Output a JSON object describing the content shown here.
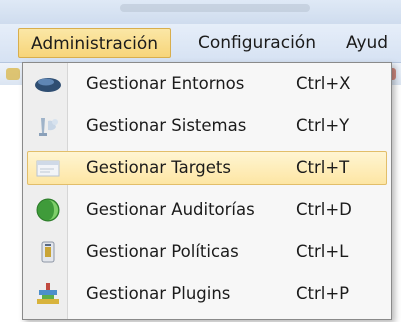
{
  "menubar": {
    "items": [
      {
        "label": "Administración",
        "active": true
      },
      {
        "label": "Configuración",
        "active": false
      },
      {
        "label": "Ayud",
        "active": false
      }
    ]
  },
  "dropdown": {
    "items": [
      {
        "label": "Gestionar Entornos",
        "shortcut": "Ctrl+X",
        "icon": "environment-icon",
        "highlighted": false
      },
      {
        "label": "Gestionar Sistemas",
        "shortcut": "Ctrl+Y",
        "icon": "systems-icon",
        "highlighted": false
      },
      {
        "label": "Gestionar Targets",
        "shortcut": "Ctrl+T",
        "icon": "targets-icon",
        "highlighted": true
      },
      {
        "label": "Gestionar Auditorías",
        "shortcut": "Ctrl+D",
        "icon": "audits-icon",
        "highlighted": false
      },
      {
        "label": "Gestionar Políticas",
        "shortcut": "Ctrl+L",
        "icon": "policies-icon",
        "highlighted": false
      },
      {
        "label": "Gestionar Plugins",
        "shortcut": "Ctrl+P",
        "icon": "plugins-icon",
        "highlighted": false
      }
    ]
  },
  "colors": {
    "highlight": "#fde6a4",
    "highlight_border": "#e2be6a",
    "menubar": "#dbe6f5"
  }
}
